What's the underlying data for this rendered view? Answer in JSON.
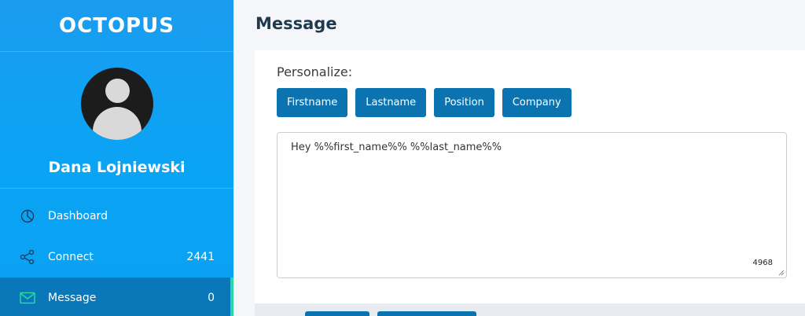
{
  "app": {
    "logo_text": "OCTOPUS"
  },
  "profile": {
    "name": "Dana Lojniewski"
  },
  "nav": {
    "items": [
      {
        "label": "Dashboard",
        "count": "",
        "icon": "pie-chart-icon"
      },
      {
        "label": "Connect",
        "count": "2441",
        "icon": "share-icon"
      },
      {
        "label": "Message",
        "count": "0",
        "icon": "envelope-icon",
        "active": true
      }
    ]
  },
  "main": {
    "title": "Message",
    "personalize_label": "Personalize:",
    "personalize_buttons": [
      "Firstname",
      "Lastname",
      "Position",
      "Company"
    ],
    "message_text": "Hey %%first_name%% %%last_name%%",
    "char_count": "4968"
  },
  "colors": {
    "sidebar": "#0aa4f5",
    "active_nav": "#0a77b8",
    "active_indicator": "#27d9a3",
    "button": "#0b73b0",
    "title": "#1e3a4c"
  }
}
